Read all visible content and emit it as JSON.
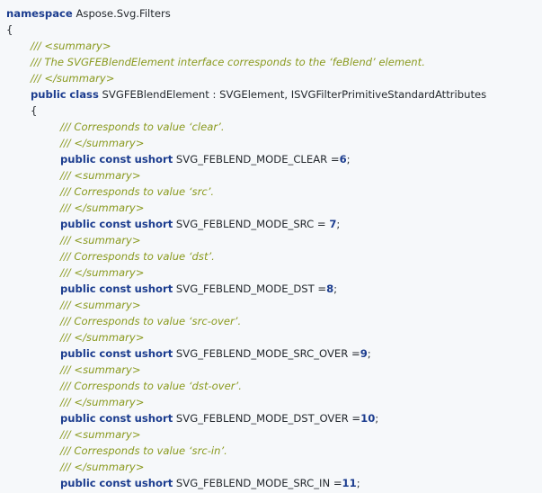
{
  "code": {
    "lines": [
      {
        "indent": 0,
        "tokens": [
          {
            "t": "namespace",
            "c": "kw"
          },
          {
            "t": " Aspose.Svg.Filters",
            "c": "plain"
          }
        ]
      },
      {
        "indent": 0,
        "tokens": [
          {
            "t": "{",
            "c": "plain"
          }
        ]
      },
      {
        "indent": 1,
        "tokens": [
          {
            "t": "/// <summary>",
            "c": "cm"
          }
        ]
      },
      {
        "indent": 1,
        "tokens": [
          {
            "t": "/// The SVGFEBlendElement interface corresponds to the ‘feBlend’ element.",
            "c": "cm"
          }
        ]
      },
      {
        "indent": 1,
        "tokens": [
          {
            "t": "/// </summary>",
            "c": "cm"
          }
        ]
      },
      {
        "indent": 1,
        "tokens": [
          {
            "t": "public",
            "c": "kw"
          },
          {
            "t": " ",
            "c": "plain"
          },
          {
            "t": "class",
            "c": "kw"
          },
          {
            "t": " SVGFEBlendElement : SVGElement, ISVGFilterPrimitiveStandardAttributes",
            "c": "plain"
          }
        ]
      },
      {
        "indent": 1,
        "tokens": [
          {
            "t": "{",
            "c": "plain"
          }
        ]
      },
      {
        "indent": 2,
        "tokens": [
          {
            "t": "/// Corresponds to value ‘clear’.",
            "c": "cm"
          }
        ]
      },
      {
        "indent": 2,
        "tokens": [
          {
            "t": "/// </summary>",
            "c": "cm"
          }
        ]
      },
      {
        "indent": 2,
        "tokens": [
          {
            "t": "public",
            "c": "kw"
          },
          {
            "t": " ",
            "c": "plain"
          },
          {
            "t": "const",
            "c": "kw"
          },
          {
            "t": " ",
            "c": "plain"
          },
          {
            "t": "ushort",
            "c": "kw"
          },
          {
            "t": " SVG_FEBLEND_MODE_CLEAR =",
            "c": "plain"
          },
          {
            "t": "6",
            "c": "num"
          },
          {
            "t": ";",
            "c": "plain"
          }
        ]
      },
      {
        "indent": 2,
        "tokens": [
          {
            "t": "/// <summary>",
            "c": "cm"
          }
        ]
      },
      {
        "indent": 2,
        "tokens": [
          {
            "t": "/// Corresponds to value ‘src’.",
            "c": "cm"
          }
        ]
      },
      {
        "indent": 2,
        "tokens": [
          {
            "t": "/// </summary>",
            "c": "cm"
          }
        ]
      },
      {
        "indent": 2,
        "tokens": [
          {
            "t": "public",
            "c": "kw"
          },
          {
            "t": " ",
            "c": "plain"
          },
          {
            "t": "const",
            "c": "kw"
          },
          {
            "t": " ",
            "c": "plain"
          },
          {
            "t": "ushort",
            "c": "kw"
          },
          {
            "t": " SVG_FEBLEND_MODE_SRC = ",
            "c": "plain"
          },
          {
            "t": "7",
            "c": "num"
          },
          {
            "t": ";",
            "c": "plain"
          }
        ]
      },
      {
        "indent": 2,
        "tokens": [
          {
            "t": "/// <summary>",
            "c": "cm"
          }
        ]
      },
      {
        "indent": 2,
        "tokens": [
          {
            "t": "/// Corresponds to value ‘dst’.",
            "c": "cm"
          }
        ]
      },
      {
        "indent": 2,
        "tokens": [
          {
            "t": "/// </summary>",
            "c": "cm"
          }
        ]
      },
      {
        "indent": 2,
        "tokens": [
          {
            "t": "public",
            "c": "kw"
          },
          {
            "t": " ",
            "c": "plain"
          },
          {
            "t": "const",
            "c": "kw"
          },
          {
            "t": " ",
            "c": "plain"
          },
          {
            "t": "ushort",
            "c": "kw"
          },
          {
            "t": " SVG_FEBLEND_MODE_DST =",
            "c": "plain"
          },
          {
            "t": "8",
            "c": "num"
          },
          {
            "t": ";",
            "c": "plain"
          }
        ]
      },
      {
        "indent": 2,
        "tokens": [
          {
            "t": "/// <summary>",
            "c": "cm"
          }
        ]
      },
      {
        "indent": 2,
        "tokens": [
          {
            "t": "/// Corresponds to value ‘src-over’.",
            "c": "cm"
          }
        ]
      },
      {
        "indent": 2,
        "tokens": [
          {
            "t": "/// </summary>",
            "c": "cm"
          }
        ]
      },
      {
        "indent": 2,
        "tokens": [
          {
            "t": "public",
            "c": "kw"
          },
          {
            "t": " ",
            "c": "plain"
          },
          {
            "t": "const",
            "c": "kw"
          },
          {
            "t": " ",
            "c": "plain"
          },
          {
            "t": "ushort",
            "c": "kw"
          },
          {
            "t": " SVG_FEBLEND_MODE_SRC_OVER =",
            "c": "plain"
          },
          {
            "t": "9",
            "c": "num"
          },
          {
            "t": ";",
            "c": "plain"
          }
        ]
      },
      {
        "indent": 2,
        "tokens": [
          {
            "t": "/// <summary>",
            "c": "cm"
          }
        ]
      },
      {
        "indent": 2,
        "tokens": [
          {
            "t": "/// Corresponds to value ‘dst-over’.",
            "c": "cm"
          }
        ]
      },
      {
        "indent": 2,
        "tokens": [
          {
            "t": "/// </summary>",
            "c": "cm"
          }
        ]
      },
      {
        "indent": 2,
        "tokens": [
          {
            "t": "public",
            "c": "kw"
          },
          {
            "t": " ",
            "c": "plain"
          },
          {
            "t": "const",
            "c": "kw"
          },
          {
            "t": " ",
            "c": "plain"
          },
          {
            "t": "ushort",
            "c": "kw"
          },
          {
            "t": " SVG_FEBLEND_MODE_DST_OVER =",
            "c": "plain"
          },
          {
            "t": "10",
            "c": "num"
          },
          {
            "t": ";",
            "c": "plain"
          }
        ]
      },
      {
        "indent": 2,
        "tokens": [
          {
            "t": "/// <summary>",
            "c": "cm"
          }
        ]
      },
      {
        "indent": 2,
        "tokens": [
          {
            "t": "/// Corresponds to value ‘src-in’.",
            "c": "cm"
          }
        ]
      },
      {
        "indent": 2,
        "tokens": [
          {
            "t": "/// </summary>",
            "c": "cm"
          }
        ]
      },
      {
        "indent": 2,
        "tokens": [
          {
            "t": "public",
            "c": "kw"
          },
          {
            "t": " ",
            "c": "plain"
          },
          {
            "t": "const",
            "c": "kw"
          },
          {
            "t": " ",
            "c": "plain"
          },
          {
            "t": "ushort",
            "c": "kw"
          },
          {
            "t": " SVG_FEBLEND_MODE_SRC_IN =",
            "c": "plain"
          },
          {
            "t": "11",
            "c": "num"
          },
          {
            "t": ";",
            "c": "plain"
          }
        ]
      }
    ]
  }
}
